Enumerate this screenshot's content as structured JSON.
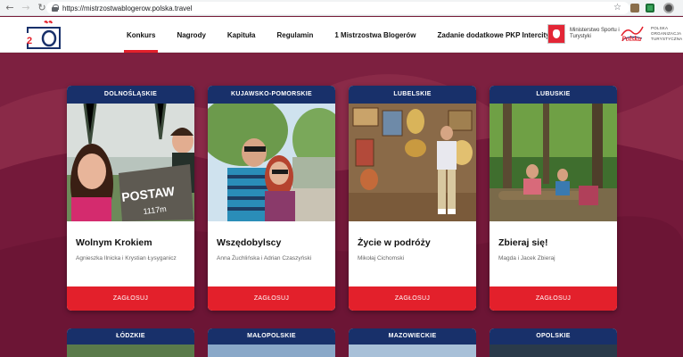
{
  "browser": {
    "back_icon": "arrow-left-icon",
    "forward_icon": "arrow-right-icon",
    "reload_icon": "reload-icon",
    "url": "https://mistrzostwablogerow.polska.travel",
    "star_icon": "star-icon"
  },
  "header": {
    "nav": [
      {
        "label": "Konkurs",
        "active": true
      },
      {
        "label": "Nagrody"
      },
      {
        "label": "Kapituła"
      },
      {
        "label": "Regulamin"
      },
      {
        "label": "1 Mistrzostwa Blogerów"
      },
      {
        "label": "Zadanie dodatkowe PKP Intercity"
      }
    ],
    "ministry": "Ministerstwo Sportu i Turystyki",
    "polska_logo": "Polska",
    "pot": "POLSKA ORGANIZACJA TURYSTYCZNA"
  },
  "colors": {
    "background": "#7a1f3a",
    "card_header": "#18306a",
    "vote_button": "#e3202b"
  },
  "cards": [
    {
      "region": "DOLNOŚLĄSKIE",
      "title": "Wolnym Krokiem",
      "authors": "Agnieszka Ilnicka i Krystian Łysyganicz",
      "vote": "ZAGŁOSUJ",
      "sign": "POSTAW",
      "sign2": "1117m"
    },
    {
      "region": "KUJAWSKO-POMORSKIE",
      "title": "Wszędobylscy",
      "authors": "Anna Żuchlińska i Adrian Czaszyński",
      "vote": "ZAGŁOSUJ"
    },
    {
      "region": "LUBELSKIE",
      "title": "Życie w podróży",
      "authors": "Mikołaj Cichomski",
      "vote": "ZAGŁOSUJ"
    },
    {
      "region": "LUBUSKIE",
      "title": "Zbieraj się!",
      "authors": "Magda i Jacek Zbieraj",
      "vote": "ZAGŁOSUJ"
    }
  ],
  "next_row": [
    {
      "region": "ŁÓDZKIE"
    },
    {
      "region": "MAŁOPOLSKIE"
    },
    {
      "region": "MAZOWIECKIE"
    },
    {
      "region": "OPOLSKIE"
    }
  ]
}
